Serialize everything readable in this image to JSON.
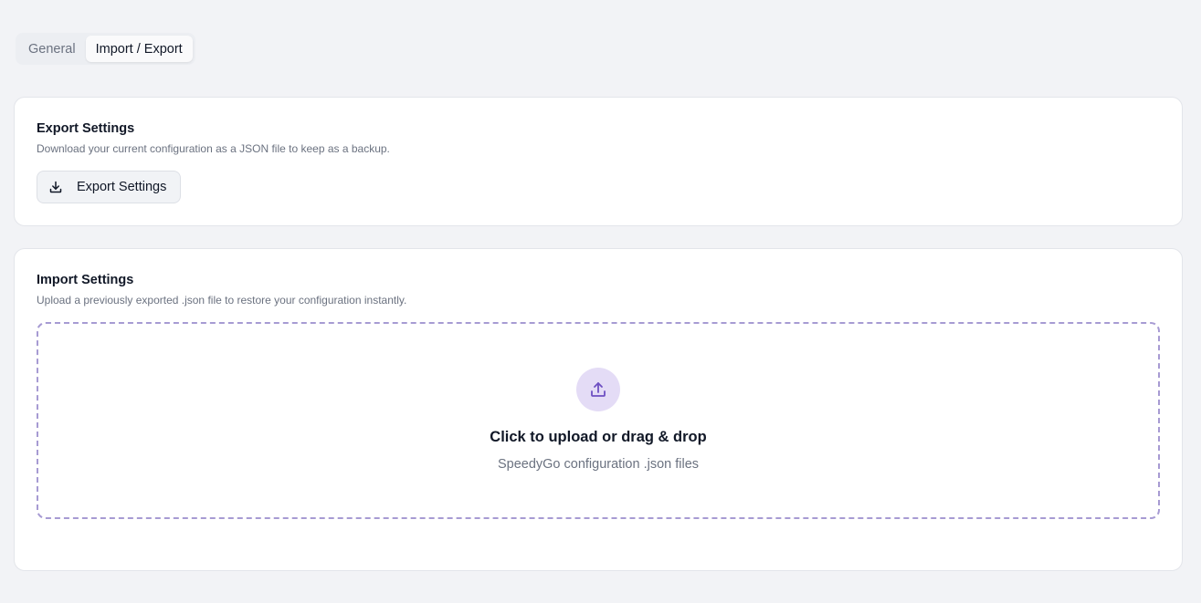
{
  "tabs": [
    {
      "label": "General",
      "active": false
    },
    {
      "label": "Import / Export",
      "active": true
    }
  ],
  "export": {
    "title": "Export Settings",
    "description": "Download your current configuration as a JSON file to keep as a backup.",
    "button_label": "Export Settings",
    "button_icon": "download-icon"
  },
  "import": {
    "title": "Import Settings",
    "description": "Upload a previously exported .json file to restore your configuration instantly.",
    "dropzone_title": "Click to upload or drag & drop",
    "dropzone_subtitle": "SpeedyGo configuration .json files",
    "dropzone_icon": "upload-icon"
  },
  "colors": {
    "accent": "#6d4fc2",
    "accent_soft": "#e4dcf6",
    "dropzone_border": "#a79bd3",
    "background": "#f2f3f6"
  }
}
